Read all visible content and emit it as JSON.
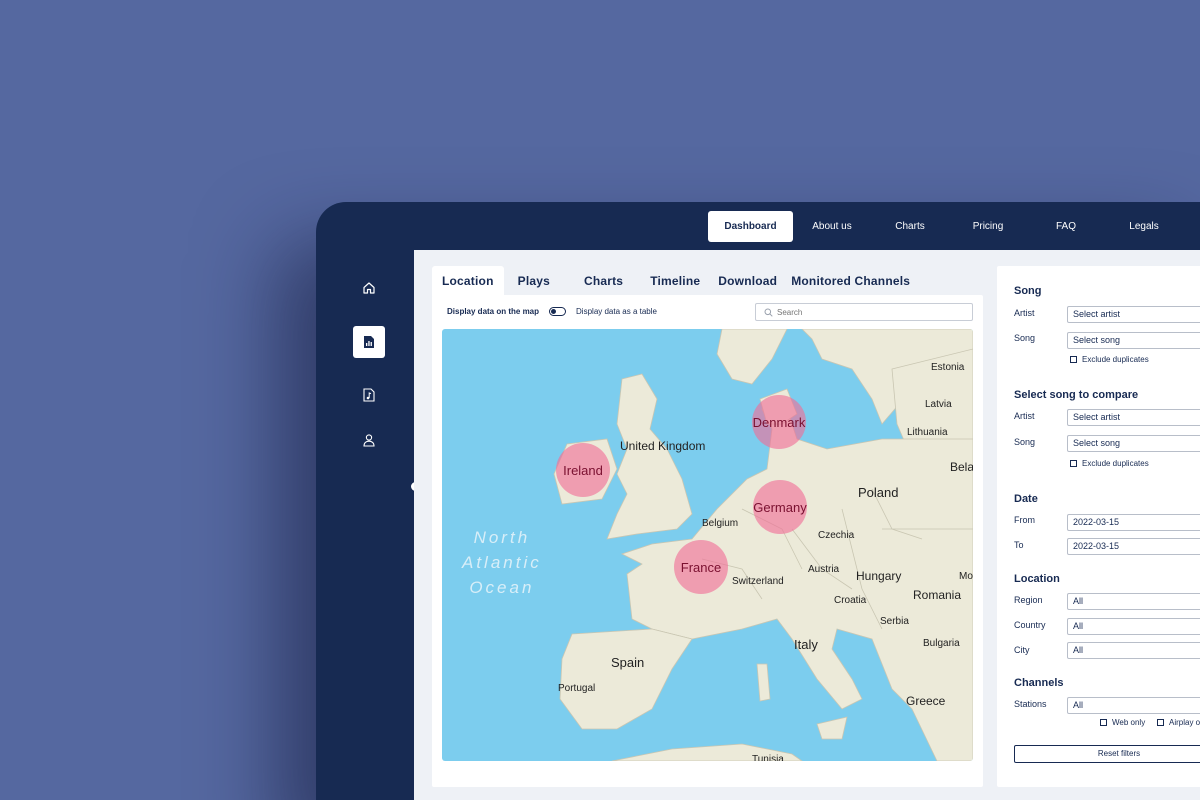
{
  "nav": {
    "items": [
      {
        "label": "Dashboard",
        "active": true
      },
      {
        "label": "About us"
      },
      {
        "label": "Charts"
      },
      {
        "label": "Pricing"
      },
      {
        "label": "FAQ"
      },
      {
        "label": "Legals"
      }
    ]
  },
  "sidebar": {
    "items": [
      {
        "icon": "home-icon"
      },
      {
        "icon": "report-icon",
        "active": true
      },
      {
        "icon": "music-file-icon"
      },
      {
        "icon": "user-icon"
      }
    ]
  },
  "tabs": [
    "Location",
    "Plays",
    "Charts",
    "Timeline",
    "Download",
    "Monitored Channels"
  ],
  "view_toggle": {
    "map_label": "Display data on the map",
    "table_label": "Display data as a table"
  },
  "search": {
    "placeholder": "Search"
  },
  "map": {
    "ocean_label": [
      "North",
      "Atlantic",
      "Ocean"
    ],
    "countries": [
      "United Kingdom",
      "Belgium",
      "Czechia",
      "Poland",
      "Austria",
      "Switzerland",
      "Hungary",
      "Croatia",
      "Romania",
      "Serbia",
      "Bulgaria",
      "Italy",
      "Spain",
      "Portugal",
      "Greece",
      "Estonia",
      "Latvia",
      "Lithuania",
      "Bela",
      "Mo",
      "Tunisia"
    ],
    "bubbles": [
      "Ireland",
      "Denmark",
      "Germany",
      "France"
    ]
  },
  "filters": {
    "song": {
      "title": "Song",
      "artist_label": "Artist",
      "artist_value": "Select artist",
      "song_label": "Song",
      "song_value": "Select song",
      "exclude": "Exclude duplicates"
    },
    "compare": {
      "title": "Select song to compare",
      "artist_label": "Artist",
      "artist_value": "Select artist",
      "song_label": "Song",
      "song_value": "Select song",
      "exclude": "Exclude duplicates"
    },
    "date": {
      "title": "Date",
      "from_label": "From",
      "from_value": "2022-03-15",
      "to_label": "To",
      "to_value": "2022-03-15"
    },
    "location": {
      "title": "Location",
      "region_label": "Region",
      "region_value": "All",
      "country_label": "Country",
      "country_value": "All",
      "city_label": "City",
      "city_value": "All"
    },
    "channels": {
      "title": "Channels",
      "stations_label": "Stations",
      "stations_value": "All",
      "web_only": "Web only",
      "airplay": "Airplay o"
    },
    "reset": "Reset filters"
  }
}
